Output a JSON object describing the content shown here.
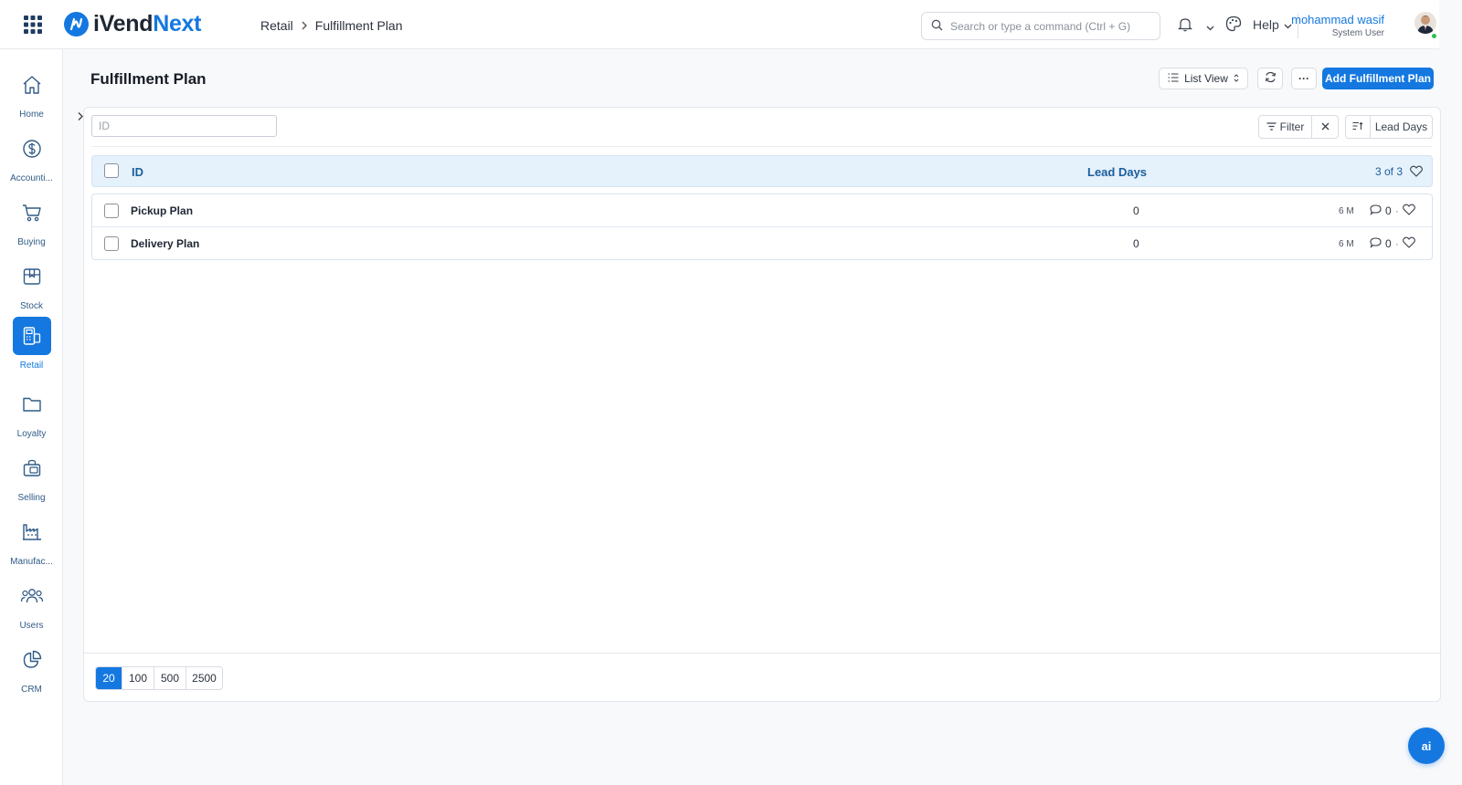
{
  "app": {
    "logo_part1": "iVend",
    "logo_part2": "Next",
    "logo_icon": "ivend-logo-icon"
  },
  "breadcrumb": {
    "items": [
      "Retail",
      "Fulfillment Plan"
    ],
    "separator_icon": "chevron-right-icon"
  },
  "search": {
    "placeholder": "Search or type a command (Ctrl + G)",
    "value": ""
  },
  "navbar": {
    "help_label": "Help"
  },
  "user": {
    "name": "mohammad wasif",
    "role": "System User",
    "status_color": "#2cbf57"
  },
  "sidebar": {
    "items": [
      {
        "label": "Home",
        "icon": "home-icon",
        "active": false
      },
      {
        "label": "Accounti...",
        "icon": "dollar-circle-icon",
        "active": false
      },
      {
        "label": "Buying",
        "icon": "cart-icon",
        "active": false
      },
      {
        "label": "Stock",
        "icon": "box-icon",
        "active": false
      },
      {
        "label": "Retail",
        "icon": "pos-terminal-icon",
        "active": true
      },
      {
        "label": "Loyalty",
        "icon": "folder-icon",
        "active": false
      },
      {
        "label": "Selling",
        "icon": "shopping-bag-icon",
        "active": false
      },
      {
        "label": "Manufac...",
        "icon": "factory-icon",
        "active": false
      },
      {
        "label": "Users",
        "icon": "users-icon",
        "active": false
      },
      {
        "label": "CRM",
        "icon": "pie-chart-icon",
        "active": false
      }
    ]
  },
  "page": {
    "title": "Fulfillment Plan",
    "list_view_label": "List View",
    "more_label": "···",
    "add_button_label": "Add Fulfillment Plan"
  },
  "filters": {
    "id_placeholder": "ID",
    "id_value": "",
    "filter_label": "Filter",
    "sort_label": "Lead Days"
  },
  "table": {
    "columns": {
      "id": "ID",
      "lead_days": "Lead Days"
    },
    "count_label": "3 of 3",
    "rows": [
      {
        "name": "Pickup Plan",
        "lead_days": "0",
        "modified": "6 M",
        "comments": "0"
      },
      {
        "name": "Delivery Plan",
        "lead_days": "0",
        "modified": "6 M",
        "comments": "0"
      }
    ]
  },
  "pagination": {
    "options": [
      "20",
      "100",
      "500",
      "2500"
    ],
    "selected": "20"
  },
  "assistant": {
    "label": "ai"
  },
  "colors": {
    "accent": "#1478e0",
    "header_row_bg": "#e5f1fb",
    "header_text": "#1b5e9c"
  }
}
